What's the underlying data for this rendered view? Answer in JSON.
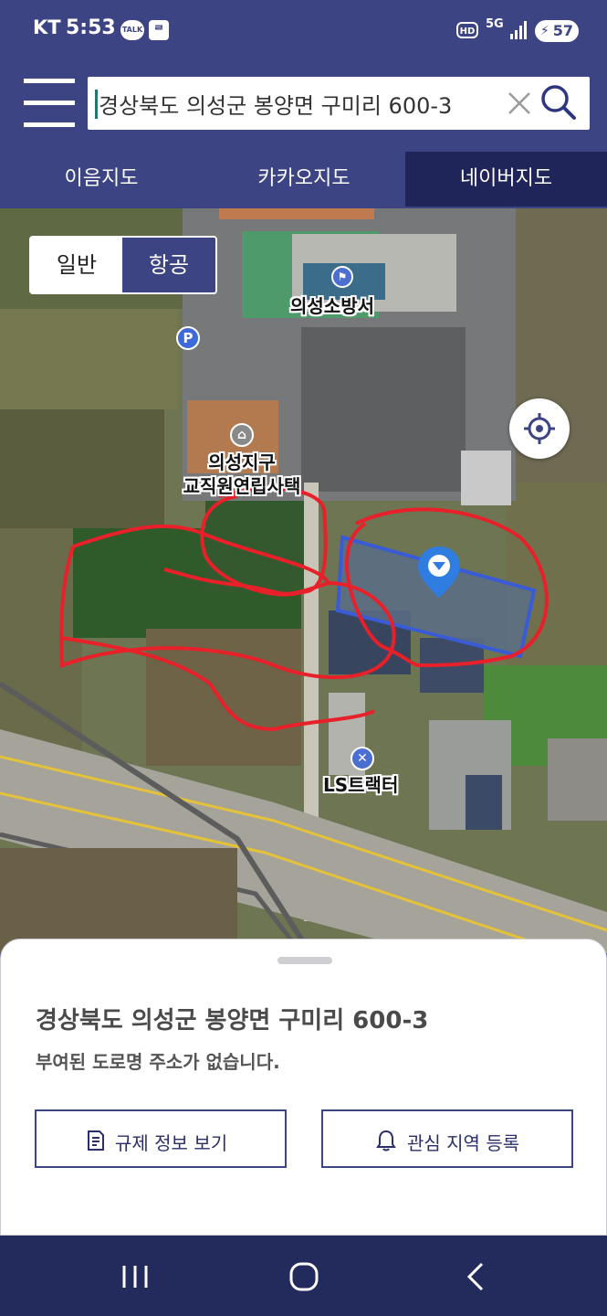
{
  "status_bar": {
    "carrier": "KT",
    "time": "5:53",
    "talk_badge": "TALK",
    "app_badge": "ᄅ",
    "hd_badge": "HD",
    "network": "5G",
    "battery": "57"
  },
  "search": {
    "value": "경상북도 의성군 봉양면 구미리 600-3"
  },
  "tabs": [
    {
      "label": "이음지도",
      "active": false
    },
    {
      "label": "카카오지도",
      "active": false
    },
    {
      "label": "네이버지도",
      "active": true
    }
  ],
  "map": {
    "type_toggle": [
      {
        "label": "일반",
        "active": false
      },
      {
        "label": "항공",
        "active": true
      }
    ],
    "labels": {
      "fire_station": "의성소방서",
      "housing_line1": "의성지구",
      "housing_line2": "교직원연립사택",
      "tractor": "LS트랙터",
      "parking": "P"
    },
    "parcel_color": "#3a5bd6",
    "annotation_color": "#e8202a"
  },
  "sheet": {
    "address": "경상북도 의성군 봉양면 구미리 600-3",
    "road_address": "부여된 도로명 주소가 없습니다.",
    "btn_regulation": "규제 정보 보기",
    "btn_interest": "관심 지역 등록"
  },
  "colors": {
    "primary": "#3d4484",
    "tab_active": "#1f2558",
    "nav_bar": "#232a5c"
  }
}
